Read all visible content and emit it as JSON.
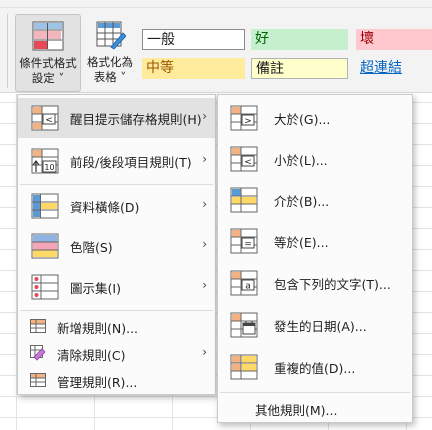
{
  "ribbon": {
    "cond_format_label": "條件式格式\n設定 ˅",
    "format_table_label": "格式化為\n表格 ˅",
    "styles": {
      "normal": "一般",
      "good": "好",
      "bad": "壞",
      "neutral": "中等",
      "note": "備註",
      "hyperlink": "超連結"
    }
  },
  "menu1": {
    "items": [
      {
        "label": "醒目提示儲存格規則(H)",
        "has_submenu": true,
        "highlighted": true
      },
      {
        "label": "前段/後段項目規則(T)",
        "has_submenu": true
      },
      {
        "label": "資料橫條(D)",
        "has_submenu": true
      },
      {
        "label": "色階(S)",
        "has_submenu": true
      },
      {
        "label": "圖示集(I)",
        "has_submenu": true
      }
    ],
    "bottom_items": [
      {
        "label": "新增規則(N)..."
      },
      {
        "label": "清除規則(C)",
        "has_submenu": true
      },
      {
        "label": "管理規則(R)..."
      }
    ]
  },
  "menu2": {
    "items": [
      {
        "label": "大於(G)..."
      },
      {
        "label": "小於(L)..."
      },
      {
        "label": "介於(B)..."
      },
      {
        "label": "等於(E)..."
      },
      {
        "label": "包含下列的文字(T)..."
      },
      {
        "label": "發生的日期(A)..."
      },
      {
        "label": "重複的值(D)..."
      }
    ],
    "more_rules": "其他規則(M)..."
  },
  "colors": {
    "good_bg": "#c6efce",
    "good_fg": "#006100",
    "bad_bg": "#ffc7ce",
    "bad_fg": "#9c0006",
    "neutral_bg": "#ffeb9c",
    "neutral_fg": "#9c5700",
    "note_bg": "#ffffcc",
    "hyperlink": "#0563c1"
  }
}
